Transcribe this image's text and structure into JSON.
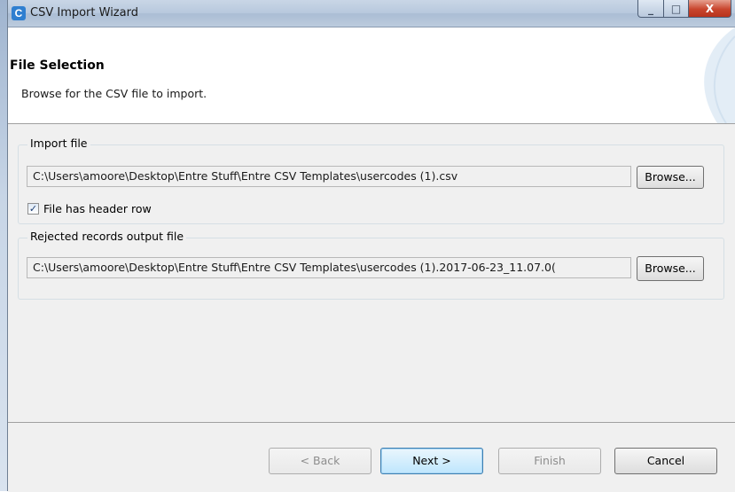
{
  "window": {
    "title": "CSV Import Wizard",
    "app_icon_glyph": "C",
    "controls": {
      "minimize": "_",
      "maximize": "□",
      "close": "X"
    }
  },
  "header": {
    "title": "File Selection",
    "description": "Browse for the CSV file to import."
  },
  "import_file": {
    "legend": "Import file",
    "path": "C:\\Users\\amoore\\Desktop\\Entre Stuff\\Entre CSV Templates\\usercodes (1).csv",
    "browse_label": "Browse...",
    "header_row_label": "File has header row",
    "header_row_checked": true,
    "checkmark": "✓"
  },
  "rejected_file": {
    "legend": "Rejected records output file",
    "path": "C:\\Users\\amoore\\Desktop\\Entre Stuff\\Entre CSV Templates\\usercodes (1).2017-06-23_11.07.0(",
    "browse_label": "Browse..."
  },
  "footer": {
    "back_label": "< Back",
    "next_label": "Next >",
    "finish_label": "Finish",
    "cancel_label": "Cancel"
  },
  "colors": {
    "accent": "#3c7fb1",
    "close_button": "#c8452d",
    "dialog_bg": "#f0f0f0"
  },
  "icons": [
    "app-icon",
    "minimize-icon",
    "maximize-icon",
    "close-icon",
    "checkmark-icon",
    "banner-decoration-icon"
  ]
}
